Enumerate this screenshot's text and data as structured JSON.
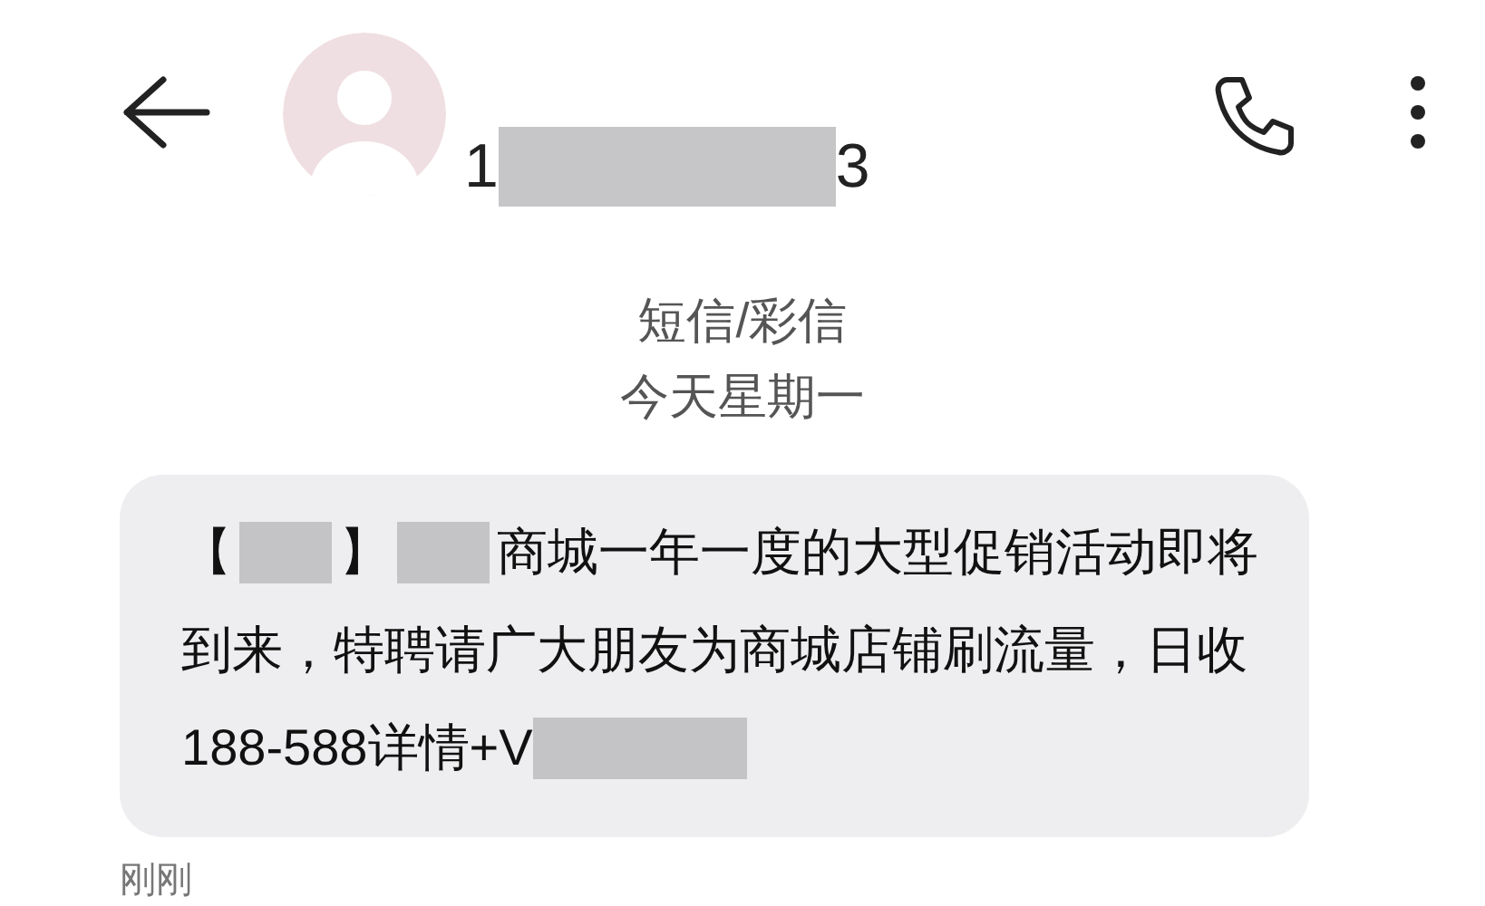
{
  "header": {
    "contact_segments": [
      {
        "kind": "text",
        "text": "1"
      },
      {
        "kind": "mask_wide"
      },
      {
        "kind": "text",
        "text": "3"
      }
    ]
  },
  "thread_info": {
    "channel": "短信/彩信",
    "date": "今天星期一"
  },
  "message": {
    "lines": [
      [
        {
          "kind": "text",
          "text": "【"
        },
        {
          "kind": "mask_short"
        },
        {
          "kind": "text",
          "text": "】"
        },
        {
          "kind": "mask_short"
        },
        {
          "kind": "text",
          "text": "商城一年一度的大型促销活动即将"
        }
      ],
      [
        {
          "kind": "text",
          "text": "到来，特聘请广大朋友为商城店铺刷流量，日收"
        }
      ],
      [
        {
          "kind": "text",
          "text": "188-588详情+V"
        },
        {
          "kind": "mask_long"
        }
      ]
    ],
    "time": "刚刚"
  }
}
